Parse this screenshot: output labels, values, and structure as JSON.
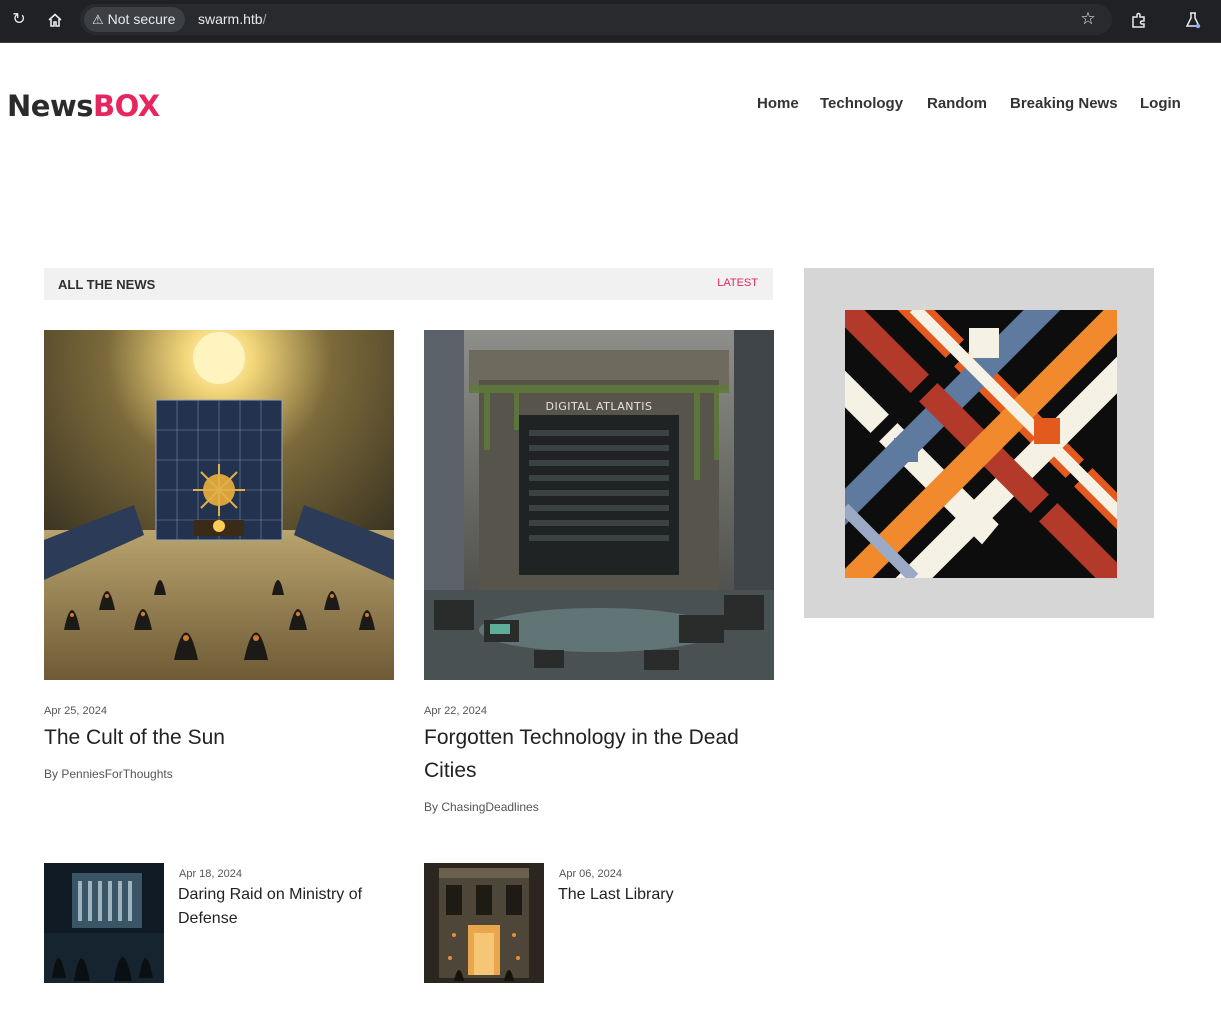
{
  "browser": {
    "security_label": "Not secure",
    "url_host": "swarm.htb",
    "url_path": "/"
  },
  "logo": {
    "part1": "News",
    "part2": "BOX"
  },
  "nav": [
    {
      "label": "Home"
    },
    {
      "label": "Technology"
    },
    {
      "label": "Random"
    },
    {
      "label": "Breaking News"
    },
    {
      "label": "Login"
    }
  ],
  "section": {
    "title": "ALL THE NEWS",
    "link": "LATEST"
  },
  "featured": [
    {
      "date": "Apr 25, 2024",
      "title": "The Cult of the Sun",
      "author": "By PenniesForThoughts"
    },
    {
      "date": "Apr 22, 2024",
      "title": "Forgotten Technology in the Dead Cities",
      "author": "By ChasingDeadlines",
      "sign": "DIGITAL ATLANTIS"
    }
  ],
  "more": [
    {
      "date": "Apr 18, 2024",
      "title": "Daring Raid on Ministry of Defense"
    },
    {
      "date": "Apr 06, 2024",
      "title": "The Last Library"
    }
  ],
  "colors": {
    "accent": "#e8265e",
    "chrome": "#202124"
  }
}
